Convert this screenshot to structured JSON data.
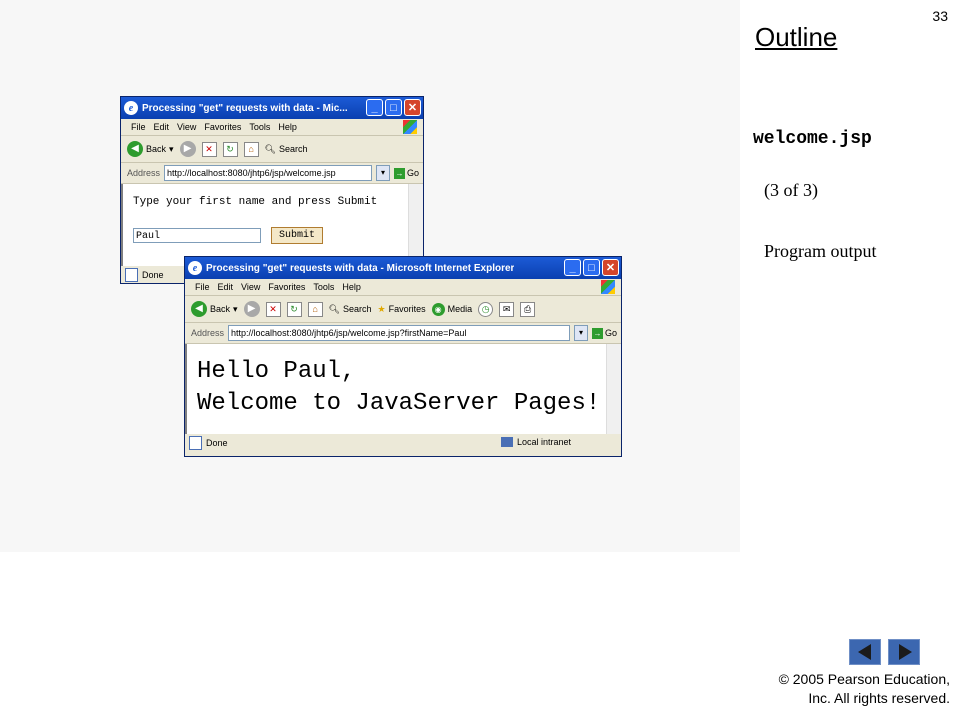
{
  "slide": {
    "page_number": "33",
    "outline_title": "Outline",
    "file_name": "welcome.jsp",
    "part_label": "(3 of 3)",
    "output_label": "Program output",
    "copyright_line1": "© 2005 Pearson Education,",
    "copyright_line2": "Inc.  All rights reserved.",
    "nav": {
      "prev_icon": "triangle-left-icon",
      "next_icon": "triangle-right-icon"
    }
  },
  "window1": {
    "title": "Processing \"get\" requests with data - Mic...",
    "menu": [
      "File",
      "Edit",
      "View",
      "Favorites",
      "Tools",
      "Help"
    ],
    "toolbar": {
      "back": "Back",
      "search": "Search"
    },
    "address_label": "Address",
    "address": "http://localhost:8080/jhtp6/jsp/welcome.jsp",
    "go": "Go",
    "prompt": "Type your first name and press Submit",
    "input_value": "Paul",
    "submit_label": "Submit",
    "status": "Done"
  },
  "window2": {
    "title": "Processing \"get\" requests with data - Microsoft Internet Explorer",
    "menu": [
      "File",
      "Edit",
      "View",
      "Favorites",
      "Tools",
      "Help"
    ],
    "toolbar": {
      "back": "Back",
      "search": "Search",
      "favorites": "Favorites",
      "media": "Media"
    },
    "address_label": "Address",
    "address": "http://localhost:8080/jhtp6/jsp/welcome.jsp?firstName=Paul",
    "go": "Go",
    "greeting_line1": "Hello Paul,",
    "greeting_line2": "Welcome to JavaServer Pages!",
    "status": "Done",
    "zone": "Local intranet"
  }
}
